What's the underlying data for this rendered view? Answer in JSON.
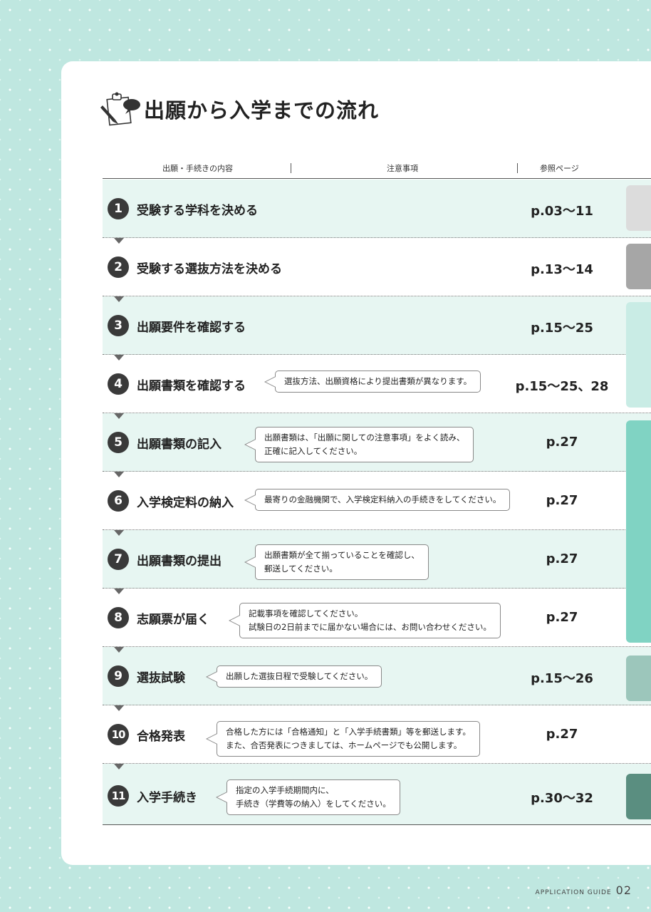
{
  "title": "出願から入学までの流れ",
  "header": {
    "col_content": "出願・手続きの内容",
    "col_notes": "注意事項",
    "col_page": "参照ページ"
  },
  "steps": [
    {
      "num": "1",
      "label": "受験する学科を決める",
      "note": [],
      "page": "p.03〜11"
    },
    {
      "num": "2",
      "label": "受験する選抜方法を決める",
      "note": [],
      "page": "p.13〜14"
    },
    {
      "num": "3",
      "label": "出願要件を確認する",
      "note": [],
      "page": "p.15〜25"
    },
    {
      "num": "4",
      "label": "出願書類を確認する",
      "note": [
        "選抜方法、出願資格により提出書類が異なります。"
      ],
      "page": "p.15〜25、28"
    },
    {
      "num": "5",
      "label": "出願書類の記入",
      "note": [
        "出願書類は、「出願に関しての注意事項」をよく読み、",
        "正確に記入してください。"
      ],
      "page": "p.27"
    },
    {
      "num": "6",
      "label": "入学検定料の納入",
      "note": [
        "最寄りの金融機関で、入学検定料納入の手続きをしてください。"
      ],
      "page": "p.27"
    },
    {
      "num": "7",
      "label": "出願書類の提出",
      "note": [
        "出願書類が全て揃っていることを確認し、",
        "郵送してください。"
      ],
      "page": "p.27"
    },
    {
      "num": "8",
      "label": "志願票が届く",
      "note": [
        "記載事項を確認してください。",
        "試験日の2日前までに届かない場合には、お問い合わせください。"
      ],
      "page": "p.27"
    },
    {
      "num": "9",
      "label": "選抜試験",
      "note": [
        "出願した選抜日程で受験してください。"
      ],
      "page": "p.15〜26"
    },
    {
      "num": "10",
      "label": "合格発表",
      "note": [
        "合格した方には「合格通知」と「入学手続書類」等を郵送します。",
        "また、合否発表につきましては、ホームページでも公開します。"
      ],
      "page": "p.27"
    },
    {
      "num": "11",
      "label": "入学手続き",
      "note": [
        "指定の入学手続期間内に、",
        "手続き（学費等の納入）をしてください。"
      ],
      "page": "p.30〜32"
    }
  ],
  "colors": {
    "shade": "#e7f6f2",
    "tab1": "#dcdcdc",
    "tab2": "#a6a6a6",
    "tab3": "#c9ece5",
    "tab4": "#80d3c3",
    "tab5": "#9cc6bb",
    "tab6": "#5a8e80"
  },
  "footer": {
    "label": "APPLICATION GUIDE",
    "page_number": "02"
  },
  "icons": [
    "pencil-clipboard-speech-icon"
  ]
}
